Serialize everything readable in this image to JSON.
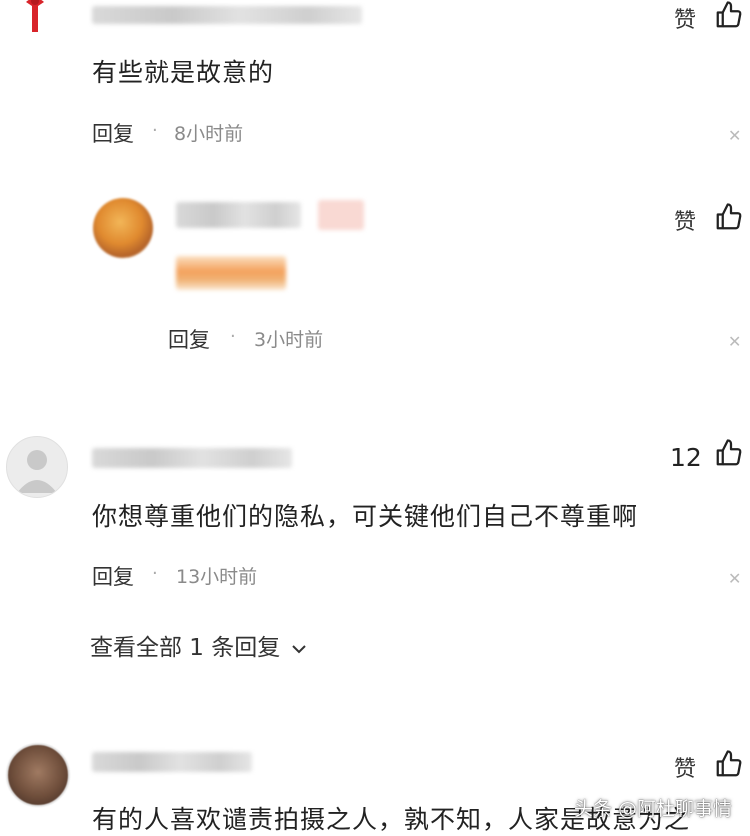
{
  "like_label": "赞",
  "reply_label": "回复",
  "comments": [
    {
      "text": "有些就是故意的",
      "time": "8小时前"
    },
    {
      "text": "",
      "time": "3小时前"
    },
    {
      "text": "你想尊重他们的隐私，可关键他们自己不尊重啊",
      "time": "13小时前",
      "likes": "12",
      "view_replies": "查看全部 1 条回复"
    },
    {
      "text": "有的人喜欢谴责拍摄之人，孰不知，人家是故意为之"
    }
  ],
  "watermark": "头条 @阿杜聊事情",
  "icons": {
    "like": "thumbs-up-icon",
    "close": "close-icon",
    "expand": "chevron-down-icon"
  },
  "colors": {
    "background": "#ffffff",
    "text": "#222222",
    "meta": "#8a8a8a",
    "accent_orange": "#f4a15c"
  }
}
